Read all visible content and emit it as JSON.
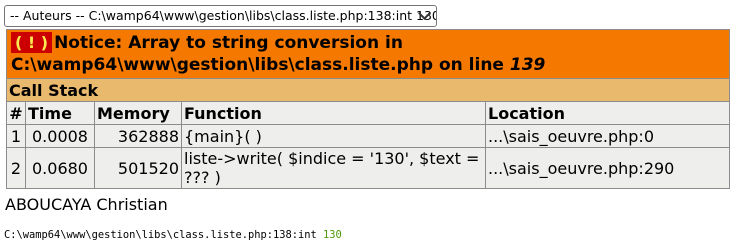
{
  "select": {
    "selected": "-- Auteurs -- C:\\wamp64\\www\\gestion\\libs\\class.liste.php:138:int 130"
  },
  "notice": {
    "icon": "( ! )",
    "text": "Notice: Array to string conversion in C:\\wamp64\\www\\gestion\\libs\\class.liste.php on line ",
    "line": "139"
  },
  "callstack": {
    "title": "Call Stack",
    "headers": {
      "num": "#",
      "time": "Time",
      "memory": "Memory",
      "function": "Function",
      "location": "Location"
    },
    "rows": [
      {
        "num": "1",
        "time": "0.0008",
        "memory": "362888",
        "function": "{main}( )",
        "location": "...\\sais_oeuvre.php:0"
      },
      {
        "num": "2",
        "time": "0.0680",
        "memory": "501520",
        "function": "liste->write( $indice = '130', $text = ??? )",
        "location": "...\\sais_oeuvre.php:290"
      }
    ]
  },
  "author": "ABOUCAYA Christian",
  "dump": {
    "path": "C:\\wamp64\\www\\gestion\\libs\\class.liste.php:138:int ",
    "value": "130"
  },
  "colors": {
    "notice_bg": "#f57900",
    "icon_bg": "#cc0000",
    "callstack_bg": "#e9b96e",
    "cell_bg": "#eeeeec",
    "dump_value": "#4e9a06"
  }
}
